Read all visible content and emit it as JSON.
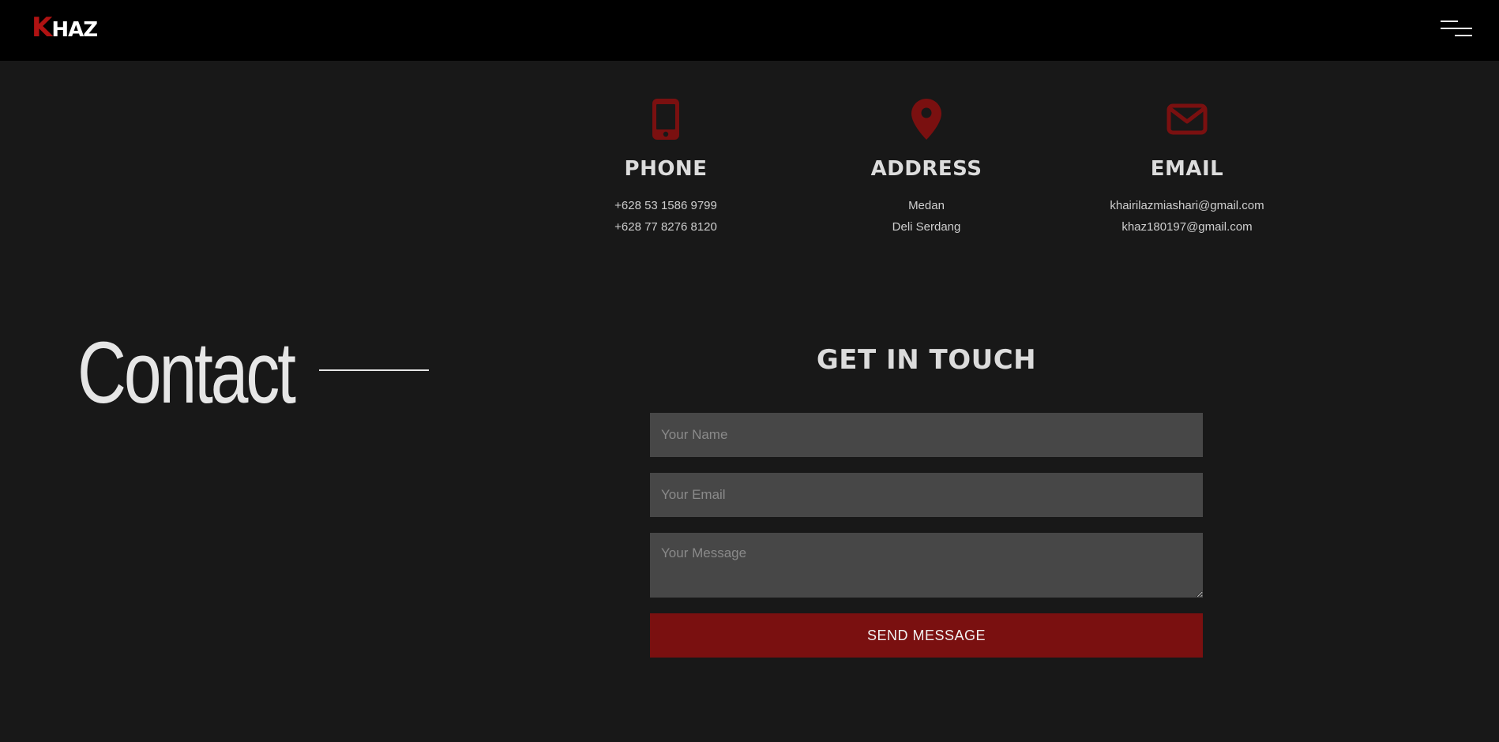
{
  "brand": {
    "logo_first": "K",
    "logo_rest": "HAZ",
    "accent_color": "#b01212"
  },
  "nav": {
    "menu_icon": "hamburger-menu-icon"
  },
  "info": {
    "phone": {
      "icon": "mobile-phone-icon",
      "title": "PHONE",
      "line1": "+628 53 1586 9799",
      "line2": "+628 77 8276 8120"
    },
    "address": {
      "icon": "map-pin-icon",
      "title": "ADDRESS",
      "line1": "Medan",
      "line2": "Deli Serdang"
    },
    "email": {
      "icon": "envelope-icon",
      "title": "EMAIL",
      "line1": "khairilazmiashari@gmail.com",
      "line2": "khaz180197@gmail.com"
    }
  },
  "section": {
    "heading": "Contact"
  },
  "form": {
    "title": "GET IN TOUCH",
    "name_placeholder": "Your Name",
    "email_placeholder": "Your Email",
    "message_placeholder": "Your Message",
    "submit_label": "SEND MESSAGE",
    "button_color": "#7a1010"
  }
}
